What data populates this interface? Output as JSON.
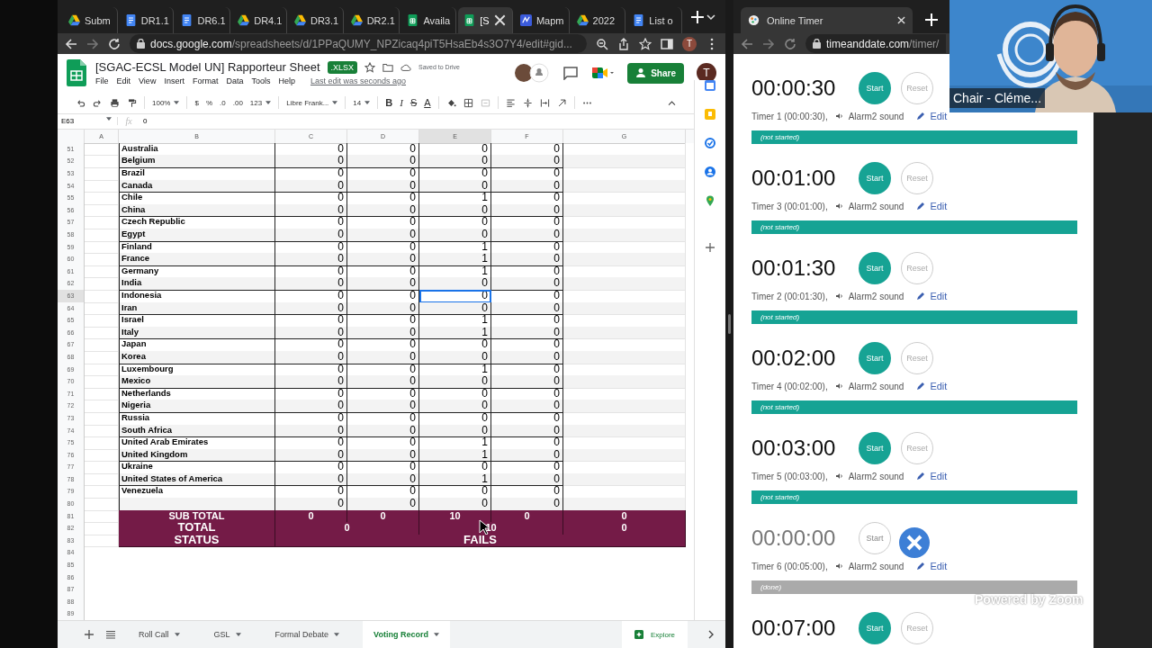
{
  "sheets_browser": {
    "tabs": [
      {
        "label": "Subm",
        "kind": "drive",
        "selected": false
      },
      {
        "label": "DR1.1",
        "kind": "docs",
        "selected": false
      },
      {
        "label": "DR6.1",
        "kind": "docs",
        "selected": false
      },
      {
        "label": "DR4.1",
        "kind": "drive",
        "selected": false
      },
      {
        "label": "DR3.1",
        "kind": "drive",
        "selected": false
      },
      {
        "label": "DR2.1",
        "kind": "drive",
        "selected": false
      },
      {
        "label": "Availa",
        "kind": "sheets",
        "selected": false
      },
      {
        "label": "[S",
        "kind": "sheets",
        "selected": true
      },
      {
        "label": "Mapm",
        "kind": "maps",
        "selected": false
      },
      {
        "label": "2022",
        "kind": "drive",
        "selected": false
      },
      {
        "label": "List o",
        "kind": "docs",
        "selected": false
      }
    ],
    "address": {
      "host": "docs.google.com",
      "path": "/spreadsheets/d/1PPaQUMY_NPZicaq4piT5HsaEb4s3O7Y4/edit#gid..."
    },
    "profile": "T"
  },
  "doc": {
    "title": "[SGAC-ECSL Model UN] Rapporteur Sheet",
    "badge": ".XLSX",
    "status": "Saved to Drive",
    "menus": [
      "File",
      "Edit",
      "View",
      "Insert",
      "Format",
      "Data",
      "Tools",
      "Help"
    ],
    "last_edit": "Last edit was seconds ago",
    "share": "Share",
    "account": "T"
  },
  "toolbar": [
    {
      "kind": "undo"
    },
    {
      "kind": "redo"
    },
    {
      "kind": "print"
    },
    {
      "kind": "paint"
    },
    {
      "kind": "sep"
    },
    {
      "kind": "text",
      "label": "100%",
      "dropdown": true
    },
    {
      "kind": "sep"
    },
    {
      "kind": "text",
      "label": "$",
      "dropdown": false
    },
    {
      "kind": "text",
      "label": "%",
      "dropdown": false
    },
    {
      "kind": "text",
      "label": ".0",
      "dropdown": false
    },
    {
      "kind": "text",
      "label": ".00",
      "dropdown": false
    },
    {
      "kind": "text",
      "label": "123",
      "dropdown": true
    },
    {
      "kind": "sep"
    },
    {
      "kind": "text",
      "label": "Libre Frank...",
      "dropdown": true
    },
    {
      "kind": "sep"
    },
    {
      "kind": "text",
      "label": "14",
      "dropdown": true
    },
    {
      "kind": "sep"
    },
    {
      "kind": "bold",
      "label": "B"
    },
    {
      "kind": "italic",
      "label": "I"
    },
    {
      "kind": "strike",
      "label": "S"
    },
    {
      "kind": "textcolor",
      "label": "A"
    },
    {
      "kind": "sep"
    },
    {
      "kind": "fill"
    },
    {
      "kind": "borders"
    },
    {
      "kind": "merge"
    },
    {
      "kind": "sep"
    },
    {
      "kind": "align"
    },
    {
      "kind": "valign"
    },
    {
      "kind": "wrap"
    },
    {
      "kind": "rotate"
    },
    {
      "kind": "sep"
    },
    {
      "kind": "more"
    }
  ],
  "formula_bar": {
    "cell": "E63",
    "fx": "fx",
    "value": "0"
  },
  "grid": {
    "columns": [
      {
        "label": "A",
        "selected": false
      },
      {
        "label": "B",
        "selected": false
      },
      {
        "label": "C",
        "selected": false
      },
      {
        "label": "D",
        "selected": false
      },
      {
        "label": "E",
        "selected": true
      },
      {
        "label": "F",
        "selected": false
      },
      {
        "label": "G",
        "selected": false
      }
    ],
    "rows": [
      {
        "number": "51",
        "name": "Australia",
        "values": [
          "0",
          "0",
          "0",
          "0"
        ],
        "selected": false
      },
      {
        "number": "52",
        "name": "Belgium",
        "values": [
          "0",
          "0",
          "0",
          "0"
        ],
        "selected": false
      },
      {
        "number": "53",
        "name": "Brazil",
        "values": [
          "0",
          "0",
          "0",
          "0"
        ],
        "selected": false
      },
      {
        "number": "54",
        "name": "Canada",
        "values": [
          "0",
          "0",
          "0",
          "0"
        ],
        "selected": false
      },
      {
        "number": "55",
        "name": "Chile",
        "values": [
          "0",
          "0",
          "1",
          "0"
        ],
        "selected": false
      },
      {
        "number": "56",
        "name": "China",
        "values": [
          "0",
          "0",
          "0",
          "0"
        ],
        "selected": false
      },
      {
        "number": "57",
        "name": "Czech Republic",
        "values": [
          "0",
          "0",
          "0",
          "0"
        ],
        "selected": false
      },
      {
        "number": "58",
        "name": "Egypt",
        "values": [
          "0",
          "0",
          "0",
          "0"
        ],
        "selected": false
      },
      {
        "number": "59",
        "name": "Finland",
        "values": [
          "0",
          "0",
          "1",
          "0"
        ],
        "selected": false
      },
      {
        "number": "60",
        "name": "France",
        "values": [
          "0",
          "0",
          "1",
          "0"
        ],
        "selected": false
      },
      {
        "number": "61",
        "name": "Germany",
        "values": [
          "0",
          "0",
          "1",
          "0"
        ],
        "selected": false
      },
      {
        "number": "62",
        "name": "India",
        "values": [
          "0",
          "0",
          "0",
          "0"
        ],
        "selected": false
      },
      {
        "number": "63",
        "name": "Indonesia",
        "values": [
          "0",
          "0",
          "0",
          "0"
        ],
        "selected": true
      },
      {
        "number": "64",
        "name": "Iran",
        "values": [
          "0",
          "0",
          "0",
          "0"
        ],
        "selected": false
      },
      {
        "number": "65",
        "name": "Israel",
        "values": [
          "0",
          "0",
          "1",
          "0"
        ],
        "selected": false
      },
      {
        "number": "66",
        "name": "Italy",
        "values": [
          "0",
          "0",
          "1",
          "0"
        ],
        "selected": false
      },
      {
        "number": "67",
        "name": "Japan",
        "values": [
          "0",
          "0",
          "0",
          "0"
        ],
        "selected": false
      },
      {
        "number": "68",
        "name": "Korea",
        "values": [
          "0",
          "0",
          "0",
          "0"
        ],
        "selected": false
      },
      {
        "number": "69",
        "name": "Luxembourg",
        "values": [
          "0",
          "0",
          "1",
          "0"
        ],
        "selected": false
      },
      {
        "number": "70",
        "name": "Mexico",
        "values": [
          "0",
          "0",
          "0",
          "0"
        ],
        "selected": false
      },
      {
        "number": "71",
        "name": "Netherlands",
        "values": [
          "0",
          "0",
          "0",
          "0"
        ],
        "selected": false
      },
      {
        "number": "72",
        "name": "Nigeria",
        "values": [
          "0",
          "0",
          "0",
          "0"
        ],
        "selected": false
      },
      {
        "number": "73",
        "name": "Russia",
        "values": [
          "0",
          "0",
          "0",
          "0"
        ],
        "selected": false
      },
      {
        "number": "74",
        "name": "South Africa",
        "values": [
          "0",
          "0",
          "0",
          "0"
        ],
        "selected": false
      },
      {
        "number": "75",
        "name": "United Arab Emirates",
        "values": [
          "0",
          "0",
          "1",
          "0"
        ],
        "selected": false
      },
      {
        "number": "76",
        "name": "United Kingdom",
        "values": [
          "0",
          "0",
          "1",
          "0"
        ],
        "selected": false
      },
      {
        "number": "77",
        "name": "Ukraine",
        "values": [
          "0",
          "0",
          "0",
          "0"
        ],
        "selected": false
      },
      {
        "number": "78",
        "name": "United States of America",
        "values": [
          "0",
          "0",
          "1",
          "0"
        ],
        "selected": false
      },
      {
        "number": "79",
        "name": "Venezuela",
        "values": [
          "0",
          "0",
          "0",
          "0"
        ],
        "selected": false
      },
      {
        "number": "80",
        "values": [
          "0",
          "0",
          "0",
          "0"
        ],
        "selected": false
      }
    ],
    "subtotal": {
      "number": "81",
      "label": "SUB TOTAL",
      "values": [
        "0",
        "0",
        "10",
        "0",
        "0"
      ]
    },
    "total": {
      "number": "82",
      "label": "TOTAL",
      "values": [
        "0",
        "10",
        "0"
      ]
    },
    "status": {
      "number": "83",
      "label": "STATUS",
      "value": "FAILS"
    },
    "empty_rows": [
      "84",
      "85",
      "86",
      "87",
      "88",
      "89"
    ]
  },
  "sheet_tabs": [
    {
      "label": "Roll Call",
      "selected": false
    },
    {
      "label": "GSL",
      "selected": false
    },
    {
      "label": "Formal Debate",
      "selected": false
    },
    {
      "label": "Voting Record",
      "selected": true
    }
  ],
  "explore": "Explore",
  "timer_browser": {
    "tab": "Online Timer",
    "address": {
      "host": "timeanddate.com",
      "path": "/timer/"
    }
  },
  "timers": [
    {
      "time": "00:00:30",
      "done": false,
      "start": "Start",
      "reset": "Reset",
      "name": "Timer 1 (00:00:30),",
      "sound": "Alarm2 sound",
      "edit": "Edit",
      "status": "(not started)"
    },
    {
      "time": "00:01:00",
      "done": false,
      "start": "Start",
      "reset": "Reset",
      "name": "Timer 3 (00:01:00),",
      "sound": "Alarm2 sound",
      "edit": "Edit",
      "status": "(not started)"
    },
    {
      "time": "00:01:30",
      "done": false,
      "start": "Start",
      "reset": "Reset",
      "name": "Timer 2 (00:01:30),",
      "sound": "Alarm2 sound",
      "edit": "Edit",
      "status": "(not started)"
    },
    {
      "time": "00:02:00",
      "done": false,
      "start": "Start",
      "reset": "Reset",
      "name": "Timer 4 (00:02:00),",
      "sound": "Alarm2 sound",
      "edit": "Edit",
      "status": "(not started)"
    },
    {
      "time": "00:03:00",
      "done": false,
      "start": "Start",
      "reset": "Reset",
      "name": "Timer 5 (00:03:00),",
      "sound": "Alarm2 sound",
      "edit": "Edit",
      "status": "(not started)"
    },
    {
      "time": "00:00:00",
      "done": true,
      "start": "Start",
      "name": "Timer 6 (00:05:00),",
      "sound": "Alarm2 sound",
      "edit": "Edit",
      "status": "(done)"
    },
    {
      "time": "00:07:00",
      "done": false,
      "start": "Start",
      "reset": "Reset"
    }
  ],
  "video": {
    "caption": "Chair - Cléme..."
  },
  "zoom_overlay": "Powered by Zoom"
}
